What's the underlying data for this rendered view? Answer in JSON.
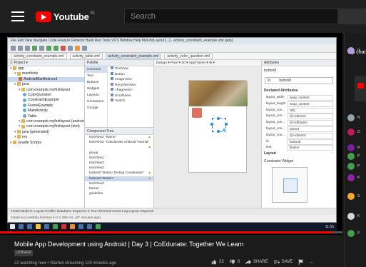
{
  "header": {
    "logo_text": "Youtube",
    "logo_superscript": "IN",
    "search_placeholder": "Search"
  },
  "video": {
    "title": "Mobile App Development using Android | Day 3 | CoEdunate: Together We Learn",
    "badge": "Unlisted",
    "meta": "22 watching now • Started streaming 119 minutes ago",
    "progress": 0.97,
    "actions": {
      "likes": "22",
      "dislikes": "0",
      "share": "SHARE",
      "save": "SAVE",
      "more": "..."
    }
  },
  "android_studio": {
    "title": "File  Edit  View  Navigate  Code  Analyze  Refactor  Build  Run  Tools  VCS  Window  Help   MyFirstLayout [...] - activity_constraint_example.xml [app]",
    "tabs": [
      "activity_constraint_example.xml",
      "activity_table.xml",
      "activity_constraint_example.xml",
      "activity_color_question.xml"
    ],
    "project_header": "1: Project ▾",
    "project_tree": [
      {
        "label": "app",
        "icon": "folder",
        "depth": 0
      },
      {
        "label": "manifests",
        "icon": "folder",
        "depth": 1
      },
      {
        "label": "AndroidManifest.xml",
        "icon": "xml",
        "depth": 2
      },
      {
        "label": "java",
        "icon": "folder",
        "depth": 1
      },
      {
        "label": "com.example.myfirstlayout",
        "icon": "folder",
        "depth": 2
      },
      {
        "label": "ColorQuestion",
        "icon": "java",
        "depth": 3
      },
      {
        "label": "ConstraintExample",
        "icon": "java",
        "depth": 3
      },
      {
        "label": "FrameExample",
        "icon": "java",
        "depth": 3
      },
      {
        "label": "MainActivity",
        "icon": "java",
        "depth": 3
      },
      {
        "label": "Table",
        "icon": "java",
        "depth": 3
      },
      {
        "label": "com.example.myfirstlayout (androidTest)",
        "icon": "folder",
        "depth": 2
      },
      {
        "label": "com.example.myfirstlayout (test)",
        "icon": "folder",
        "depth": 2
      },
      {
        "label": "java (generated)",
        "icon": "folder",
        "depth": 1
      },
      {
        "label": "res",
        "icon": "folder",
        "depth": 1
      },
      {
        "label": "Gradle Scripts",
        "icon": "folder",
        "depth": 0
      }
    ],
    "palette_header": "Palette",
    "palette_categories": [
      "Common",
      "Text",
      "Buttons",
      "Widgets",
      "Layouts",
      "Containers",
      "Google"
    ],
    "palette_items": [
      "TextView",
      "Button",
      "ImageView",
      "RecyclerView",
      "<fragment>",
      "ScrollView",
      "Switch"
    ],
    "component_tree_header": "Component Tree",
    "component_tree": [
      {
        "label": "textView2  \"Name\"",
        "warn": true
      },
      {
        "label": "textView3  \"CoEdunate Android Tutorial\"",
        "warn": true
      },
      {
        "label": "group",
        "warn": false
      },
      {
        "label": "textView1",
        "warn": false
      },
      {
        "label": "textView2",
        "warn": false
      },
      {
        "label": "textView3",
        "warn": false
      },
      {
        "label": "button6  \"Button Testing Constraints\"",
        "warn": true
      },
      {
        "label": "button8  \"Button\"",
        "warn": true
      },
      {
        "label": "textView3",
        "warn": false
      },
      {
        "label": "barrier",
        "warn": false
      },
      {
        "label": "guideline",
        "warn": false
      }
    ],
    "design_toolbar": "Design   ▾  Pixel   ▾  30 ▾  AppTheme ▾  ⊕ ▾",
    "attributes_header": "Attributes",
    "attr_widget": "button8",
    "attr_id_label": "id",
    "attr_id_value": "button8",
    "declared_header": "Declared Attributes",
    "declared_attrs": [
      {
        "k": "layout_width",
        "v": "wrap_content"
      },
      {
        "k": "layout_height",
        "v": "wrap_content"
      },
      {
        "k": "layout_con...",
        "v": "(ID)"
      },
      {
        "k": "layout_con...",
        "v": "@+id/textV"
      },
      {
        "k": "layout_con...",
        "v": "@+id/button"
      },
      {
        "k": "layout_con...",
        "v": "parent"
      },
      {
        "k": "layout_con...",
        "v": "@+id/textV"
      },
      {
        "k": "id",
        "v": "button8"
      },
      {
        "k": "text",
        "v": "Button"
      }
    ],
    "layout_header": "Layout",
    "constraint_widget_label": "Constraint Widget",
    "status_line": "TODO   Build   6: Logcat   Profiler   Database Inspector   4: Run   Terminal   Event Log   Layout Inspector",
    "status_line2": "Install successfully finished in 2 s 259 ms. (47 minutes ago)",
    "clock": "11:55"
  },
  "chat": {
    "header": "Top chat",
    "messages": [
      {
        "initial": "D",
        "color": "#b39ddb"
      },
      {
        "initial": "N",
        "color": "#90a4ae"
      },
      {
        "initial": "D",
        "color": "#c2185b"
      },
      {
        "initial": "R",
        "color": "#7b1fa2"
      },
      {
        "initial": "P",
        "color": "#43a047"
      },
      {
        "initial": "P",
        "color": "#43a047"
      },
      {
        "initial": "K",
        "color": "#8e24aa"
      },
      {
        "initial": "S",
        "color": "#f9a825"
      },
      {
        "initial": "K",
        "color": "#cfd8dc"
      },
      {
        "initial": "P",
        "color": "#43a047"
      }
    ]
  }
}
